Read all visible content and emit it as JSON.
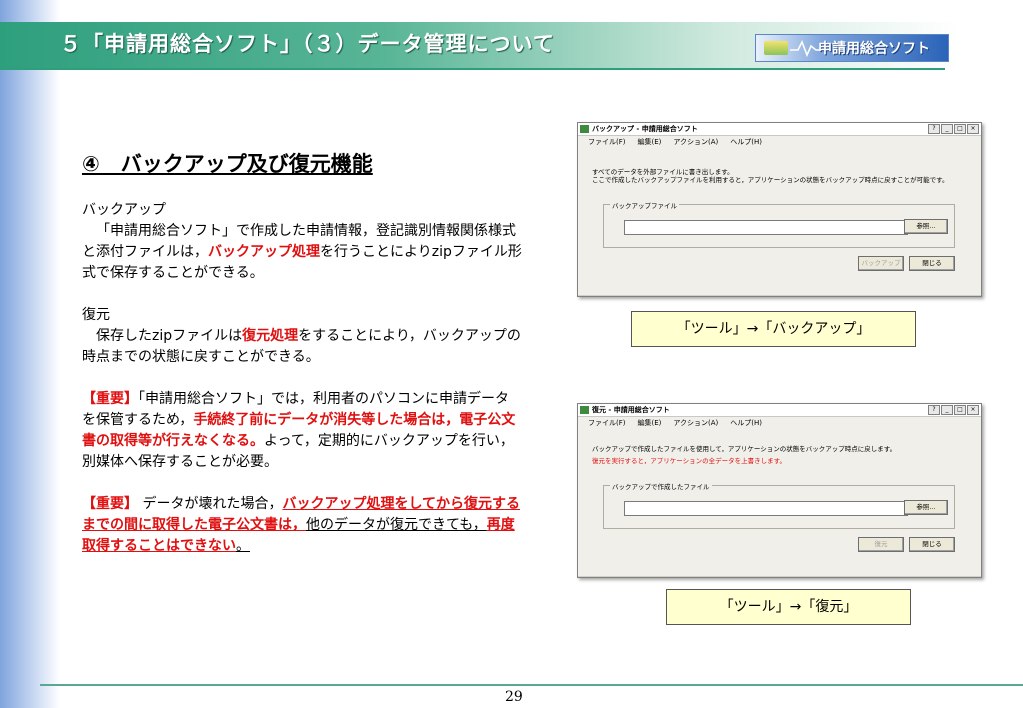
{
  "slide": {
    "title": "５「申請用総合ソフト」（３）データ管理について",
    "logo_text": "申請用総合ソフト",
    "page_number": "29"
  },
  "section": {
    "heading": "④　バックアップ及び復元機能"
  },
  "backup": {
    "label": "バックアップ",
    "text_1": "「申請用総合ソフト」で作成した申請情報，登記識別情報関係様式と添付ファイルは，",
    "highlight": "バックアップ処理",
    "text_2": "を行うことによりzipファイル形式で保存することができる。"
  },
  "restore": {
    "label": "復元",
    "text_1": "保存したzipファイルは",
    "highlight": "復元処理",
    "text_2": "をすることにより，バックアップの時点までの状態に戻すことができる。"
  },
  "important_1": {
    "tag": "【重要】",
    "text_1": "「申請用総合ソフト」では，利用者のパソコンに申請データを保管するため，",
    "highlight": "手続終了前にデータが消失等した場合は，電子公文書の取得等が行えなくなる。",
    "text_2": "よって，定期的にバックアップを行い，別媒体へ保存することが必要。"
  },
  "important_2": {
    "tag": "【重要】",
    "text_1": "データが壊れた場合，",
    "highlight": "バックアップ処理をしてから復元するまでの間に取得した電子公文書は，",
    "text_2": "他のデータが復元できても，",
    "highlight_2": "再度取得することはできない",
    "end": "。"
  },
  "backup_window": {
    "title": "バックアップ - 申請用総合ソフト",
    "menu": [
      "ファイル(F)",
      "編集(E)",
      "アクション(A)",
      "ヘルプ(H)"
    ],
    "desc_1": "すべてのデータを外部ファイルに書き出します。",
    "desc_2": "ここで作成したバックアップファイルを利用すると，アプリケーションの状態をバックアップ時点に戻すことが可能です。",
    "group_label": "バックアップファイル",
    "file_value": "",
    "browse_label": "参照...",
    "action_label": "バックアップ",
    "close_label": "閉じる",
    "caption": "「ツール」→「バックアップ」"
  },
  "restore_window": {
    "title": "復元 - 申請用総合ソフト",
    "menu": [
      "ファイル(F)",
      "編集(E)",
      "アクション(A)",
      "ヘルプ(H)"
    ],
    "desc_1": "バックアップで作成したファイルを使用して，アプリケーションの状態をバックアップ時点に戻します。",
    "desc_2": "復元を実行すると，アプリケーションの全データを上書きします。",
    "group_label": "バックアップで作成したファイル",
    "file_value": "",
    "browse_label": "参照...",
    "action_label": "復元",
    "close_label": "閉じる",
    "caption": "「ツール」→「復元」"
  },
  "colors": {
    "header_green": "#2e9f7d",
    "emphasis_red": "#e01010",
    "caption_bg": "#ffffd0"
  }
}
